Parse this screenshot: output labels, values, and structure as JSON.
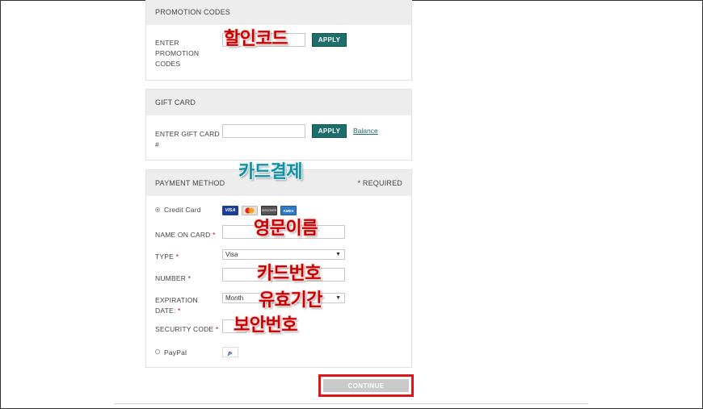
{
  "promotion": {
    "heading": "PROMOTION CODES",
    "label_line1": "ENTER",
    "label_line2": "PROMOTION",
    "label_line3": "CODES",
    "apply_label": "APPLY",
    "annotation": "할인코드"
  },
  "gift_card": {
    "heading": "GIFT CARD",
    "label_line1": "ENTER GIFT CARD",
    "label_line2": "#",
    "apply_label": "APPLY",
    "balance_link": "Balance"
  },
  "payment": {
    "heading": "PAYMENT METHOD",
    "required_note": "* REQUIRED",
    "annotation_section": "카드결제",
    "credit_card_label": "Credit Card",
    "card_icons": [
      {
        "name": "visa-icon",
        "text": "VISA",
        "color": "#1a3e9a"
      },
      {
        "name": "mastercard-icon",
        "text": "",
        "color": "#e8e2d6"
      },
      {
        "name": "discover-icon",
        "text": "DISCOVER",
        "color": "#555555"
      },
      {
        "name": "amex-icon",
        "text": "AMEX",
        "color": "#2f7bc8"
      }
    ],
    "name_on_card_label": "NAME ON CARD",
    "name_annotation": "영문이름",
    "type_label": "TYPE",
    "type_value": "Visa",
    "number_label": "NUMBER",
    "number_annotation": "카드번호",
    "expiration_label_line1": "EXPIRATION",
    "expiration_label_line2": "DATE:",
    "expiration_month": "Month",
    "expiration_year_fragment": "r",
    "expiration_annotation": "유효기간",
    "security_label": "SECURITY CODE",
    "security_annotation": "보안번호",
    "paypal_label": "PayPal",
    "required_marker": "*"
  },
  "continue_label": "CONTINUE",
  "colors": {
    "accent_teal": "#1e6e6c",
    "annotation_red": "#c40000",
    "annotation_teal": "#1a8ca0",
    "highlight_box": "#e0151b"
  }
}
